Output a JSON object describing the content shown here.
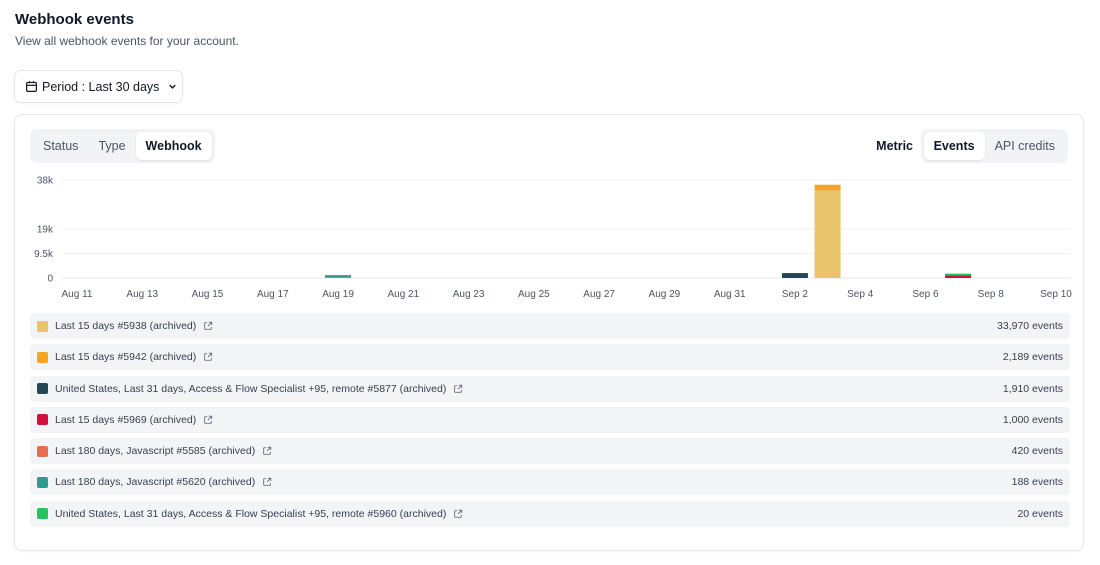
{
  "header": {
    "title": "Webhook events",
    "subtitle": "View all webhook events for your account."
  },
  "period": {
    "label": "Period : Last 30 days",
    "icon": "calendar-icon"
  },
  "tabs_left": [
    {
      "label": "Status",
      "active": false
    },
    {
      "label": "Type",
      "active": false
    },
    {
      "label": "Webhook",
      "active": true
    }
  ],
  "metric": {
    "label": "Metric",
    "options": [
      {
        "label": "Events",
        "active": true
      },
      {
        "label": "API credits",
        "active": false
      }
    ]
  },
  "chart_data": {
    "type": "bar",
    "stacked": true,
    "y_ticks": [
      "38k",
      "19k",
      "9.5k",
      "0"
    ],
    "y_tick_values": [
      38000,
      19000,
      9500,
      0
    ],
    "x_tick_labels": [
      "Aug 11",
      "Aug 13",
      "Aug 15",
      "Aug 17",
      "Aug 19",
      "Aug 21",
      "Aug 23",
      "Aug 25",
      "Aug 27",
      "Aug 29",
      "Aug 31",
      "Sep 2",
      "Sep 4",
      "Sep 6",
      "Sep 8",
      "Sep 10"
    ],
    "categories": [
      "Aug 11",
      "Aug 12",
      "Aug 13",
      "Aug 14",
      "Aug 15",
      "Aug 16",
      "Aug 17",
      "Aug 18",
      "Aug 19",
      "Aug 20",
      "Aug 21",
      "Aug 22",
      "Aug 23",
      "Aug 24",
      "Aug 25",
      "Aug 26",
      "Aug 27",
      "Aug 28",
      "Aug 29",
      "Aug 30",
      "Aug 31",
      "Sep 1",
      "Sep 2",
      "Sep 3",
      "Sep 4",
      "Sep 5",
      "Sep 6",
      "Sep 7",
      "Sep 8",
      "Sep 9",
      "Sep 10"
    ],
    "ylim": [
      0,
      38000
    ],
    "grid": true,
    "series": [
      {
        "name": "Last 15 days #5938 (archived)",
        "color": "#e9c46a",
        "values": [
          0,
          0,
          0,
          0,
          0,
          0,
          0,
          0,
          0,
          0,
          0,
          0,
          0,
          0,
          0,
          0,
          0,
          0,
          0,
          0,
          0,
          0,
          0,
          33970,
          0,
          0,
          0,
          0,
          0,
          0,
          0
        ]
      },
      {
        "name": "Last 15 days #5942 (archived)",
        "color": "#f4a623",
        "values": [
          0,
          0,
          0,
          0,
          0,
          0,
          0,
          0,
          0,
          0,
          0,
          0,
          0,
          0,
          0,
          0,
          0,
          0,
          0,
          0,
          0,
          0,
          0,
          2189,
          0,
          0,
          0,
          0,
          0,
          0,
          0
        ]
      },
      {
        "name": "United States, Last 31 days, Access & Flow Specialist +95, remote #5877 (archived)",
        "color": "#264653",
        "values": [
          0,
          0,
          0,
          0,
          0,
          0,
          0,
          0,
          0,
          0,
          0,
          0,
          0,
          0,
          0,
          0,
          0,
          0,
          0,
          0,
          0,
          0,
          1910,
          0,
          0,
          0,
          0,
          0,
          0,
          0,
          0
        ]
      },
      {
        "name": "Last 15 days #5969 (archived)",
        "color": "#d1113a",
        "values": [
          0,
          0,
          0,
          0,
          0,
          0,
          0,
          0,
          0,
          0,
          0,
          0,
          0,
          0,
          0,
          0,
          0,
          0,
          0,
          0,
          0,
          0,
          0,
          0,
          0,
          0,
          0,
          1000,
          0,
          0,
          0
        ]
      },
      {
        "name": "Last 180 days, Javascript #5585 (archived)",
        "color": "#e76f51",
        "values": [
          0,
          0,
          0,
          0,
          0,
          0,
          0,
          0,
          420,
          0,
          0,
          0,
          0,
          0,
          0,
          0,
          0,
          0,
          0,
          0,
          0,
          0,
          0,
          0,
          0,
          0,
          0,
          0,
          0,
          0,
          0
        ]
      },
      {
        "name": "Last 180 days, Javascript #5620 (archived)",
        "color": "#2a9d8f",
        "values": [
          0,
          0,
          0,
          0,
          0,
          0,
          0,
          0,
          188,
          0,
          0,
          0,
          0,
          0,
          0,
          0,
          0,
          0,
          0,
          0,
          0,
          0,
          0,
          0,
          0,
          0,
          0,
          0,
          0,
          0,
          0
        ]
      },
      {
        "name": "United States, Last 31 days, Access & Flow Specialist +95, remote #5960 (archived)",
        "color": "#22c55e",
        "values": [
          0,
          0,
          0,
          0,
          0,
          0,
          0,
          0,
          0,
          0,
          0,
          0,
          0,
          0,
          0,
          0,
          0,
          0,
          0,
          0,
          0,
          0,
          0,
          0,
          0,
          0,
          0,
          20,
          0,
          0,
          0
        ]
      }
    ]
  },
  "legend": [
    {
      "name": "Last 15 days #5938 (archived)",
      "color": "#e9c46a",
      "count": "33,970 events"
    },
    {
      "name": "Last 15 days #5942 (archived)",
      "color": "#f4a623",
      "count": "2,189 events"
    },
    {
      "name": "United States, Last 31 days, Access & Flow Specialist +95, remote #5877 (archived)",
      "color": "#264653",
      "count": "1,910 events"
    },
    {
      "name": "Last 15 days #5969 (archived)",
      "color": "#d1113a",
      "count": "1,000 events"
    },
    {
      "name": "Last 180 days, Javascript #5585 (archived)",
      "color": "#e76f51",
      "count": "420 events"
    },
    {
      "name": "Last 180 days, Javascript #5620 (archived)",
      "color": "#2a9d8f",
      "count": "188 events"
    },
    {
      "name": "United States, Last 31 days, Access & Flow Specialist +95, remote #5960 (archived)",
      "color": "#22c55e",
      "count": "20 events"
    }
  ]
}
